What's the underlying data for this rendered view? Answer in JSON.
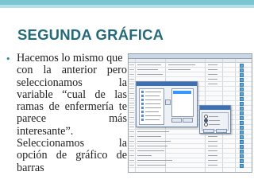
{
  "slide": {
    "title": "SEGUNDA GRÁFICA",
    "bullet": "•",
    "body_lines": [
      "Hacemos lo mismo que",
      "con la anterior pero",
      "seleccionamos la",
      "variable “cual de las",
      "ramas de enfermería te",
      "parece más",
      "interesante”.",
      "Seleccionamos la",
      "opción de gráfico de",
      "barras"
    ]
  },
  "colors": {
    "title": "#246a7a",
    "accent_bar": "#79c6d0",
    "accent_band": "#b4e1e7",
    "body_text": "#222222"
  }
}
